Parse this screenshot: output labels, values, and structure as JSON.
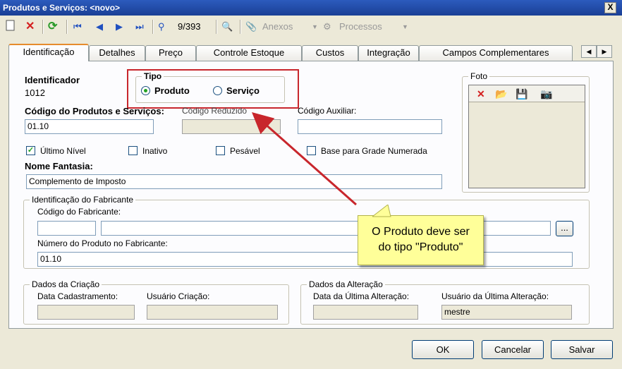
{
  "window": {
    "title": "Produtos e Serviços: <novo>",
    "close": "X"
  },
  "toolbar": {
    "record_position": "9/393",
    "anexos_label": "Anexos",
    "processos_label": "Processos"
  },
  "tabs": [
    {
      "label": "Identificação"
    },
    {
      "label": "Detalhes"
    },
    {
      "label": "Preço"
    },
    {
      "label": "Controle Estoque"
    },
    {
      "label": "Custos"
    },
    {
      "label": "Integração"
    },
    {
      "label": "Campos Complementares"
    }
  ],
  "form": {
    "identificador_label": "Identificador",
    "identificador_value": "1012",
    "tipo_label": "Tipo",
    "tipo_options": [
      {
        "label": "Produto",
        "selected": true
      },
      {
        "label": "Serviço",
        "selected": false
      }
    ],
    "codigo_label": "Código do Produtos e Serviços:",
    "codigo_value": "01.10",
    "codigo_reduzido_label": "Código Reduzido",
    "codigo_auxiliar_label": "Código Auxiliar:",
    "ultimo_nivel_label": "Último Nível",
    "ultimo_nivel_checked": true,
    "inativo_label": "Inativo",
    "pesavel_label": "Pesável",
    "base_grade_label": "Base para Grade Numerada",
    "nome_fantasia_label": "Nome Fantasia:",
    "nome_fantasia_value": "Complemento de Imposto",
    "foto_label": "Foto"
  },
  "fabricante": {
    "group_title": "Identificação do Fabricante",
    "codigo_label": "Código do Fabricante:",
    "browse_label": "...",
    "numero_label": "Número do Produto no Fabricante:",
    "numero_value": "01.10"
  },
  "criacao": {
    "group_title": "Dados da Criação",
    "data_label": "Data Cadastramento:",
    "usuario_label": "Usuário Criação:"
  },
  "alteracao": {
    "group_title": "Dados da Alteração",
    "data_label": "Data da Última Alteração:",
    "usuario_label": "Usuário da Última Alteração:",
    "usuario_value": "mestre"
  },
  "buttons": {
    "ok": "OK",
    "cancelar": "Cancelar",
    "salvar": "Salvar"
  },
  "callout": {
    "line1": "O Produto deve ser",
    "line2": "do tipo \"Produto\""
  },
  "colors": {
    "annotation_red": "#c8262c",
    "note_yellow": "#ffff99",
    "title_blue": "#2c5bbd"
  }
}
